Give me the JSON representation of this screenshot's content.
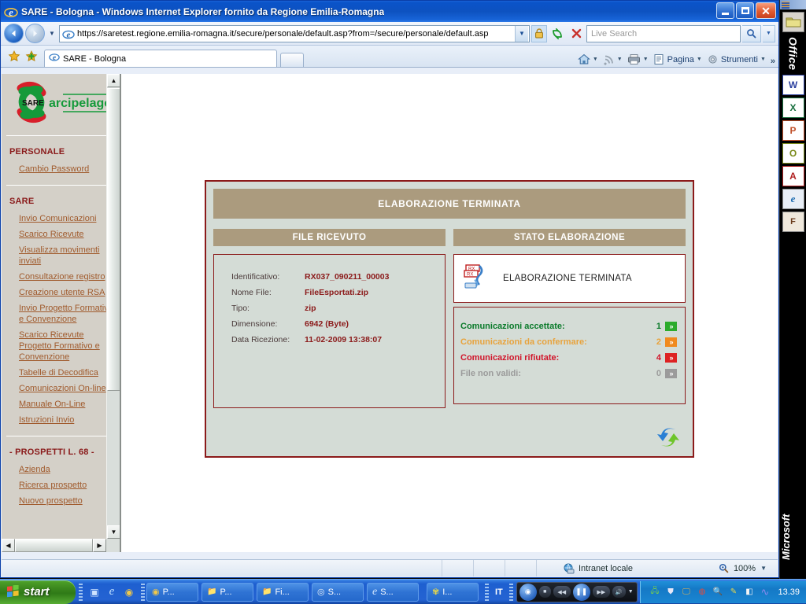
{
  "window": {
    "title": "SARE - Bologna - Windows Internet Explorer fornito da Regione Emilia-Romagna",
    "minimize_label": "",
    "maximize_label": "",
    "close_label": "✕"
  },
  "navbar": {
    "back_label": "◀",
    "forward_label": "▶",
    "history_caret": "▼",
    "url": "https://saretest.regione.emilia-romagna.it/secure/personale/default.asp?from=/secure/personale/default.asp",
    "url_dropdown_caret": "▼",
    "refresh_label": "↻",
    "stop_label": "✕",
    "search_placeholder": "Live Search",
    "search_go_label": "🔍",
    "search_caret": "▼"
  },
  "tabs": {
    "favorites_add_label": "★",
    "favorites_star_label": "✚",
    "items": [
      {
        "label": "SARE - Bologna"
      }
    ],
    "new_tab_label": ""
  },
  "command_bar": {
    "home_label": "",
    "feeds_label": "",
    "print_label": "",
    "page_label": "Pagina",
    "tools_label": "Strumenti",
    "overflow_label": "»",
    "caret": "▼"
  },
  "sidebar": {
    "logo_text": "SARE",
    "logo_word": "arcipelago",
    "sections": [
      {
        "heading": "PERSONALE",
        "links": [
          "Cambio Password"
        ]
      },
      {
        "heading": "SARE",
        "links": [
          "Invio Comunicazioni",
          "Scarico Ricevute",
          "Visualizza movimenti inviati",
          "Consultazione registro",
          "Creazione utente RSA",
          "Invio Progetto Formativo e Convenzione",
          "Scarico Ricevute Progetto Formativo e Convenzione",
          "Tabelle di Decodifica",
          "Comunicazioni On-line",
          "Manuale On-Line",
          "Istruzioni Invio"
        ]
      },
      {
        "heading": "- PROSPETTI L. 68 -",
        "links": [
          "Azienda",
          "Ricerca prospetto",
          "Nuovo prospetto"
        ]
      }
    ],
    "scroll_up_label": "▲",
    "scroll_down_label": "▼",
    "scroll_left_label": "◀",
    "scroll_right_label": "▶"
  },
  "panel": {
    "banner": "ELABORAZIONE TERMINATA",
    "left_column_header": "FILE RICEVUTO",
    "right_column_header": "STATO ELABORAZIONE",
    "file_details": [
      {
        "key": "Identificativo:",
        "value": "RX037_090211_00003"
      },
      {
        "key": "Nome File:",
        "value": "FileEsportati.zip"
      },
      {
        "key": "Tipo:",
        "value": "zip"
      },
      {
        "key": "Dimensione:",
        "value": "6942 (Byte)"
      },
      {
        "key": "Data Ricezione:",
        "value": "11-02-2009 13:38:07"
      }
    ],
    "status_title": "ELABORAZIONE TERMINATA",
    "stats": [
      {
        "label": "Comunicazioni accettate:",
        "count": "1",
        "color": "#0a7a2a",
        "badge": "#2cab2c",
        "arrows": "»"
      },
      {
        "label": "Comunicazioni da confermare:",
        "count": "2",
        "color": "#e8a33d",
        "badge": "#f08a1e",
        "arrows": "»"
      },
      {
        "label": "Comunicazioni rifiutate:",
        "count": "4",
        "color": "#d1152a",
        "badge": "#dd2222",
        "arrows": "»"
      },
      {
        "label": "File non validi:",
        "count": "0",
        "color": "#9b9b9b",
        "badge": "#9b9b9b",
        "arrows": "»"
      }
    ],
    "refresh_button_label": ""
  },
  "statusbar": {
    "zone": "Intranet locale",
    "zoom": "100%",
    "zoom_caret": "▼"
  },
  "office_bar": {
    "top_label": "Office",
    "bottom_label": "Microsoft",
    "buttons": [
      {
        "name": "folder",
        "glyph": "📁",
        "color": "#b8a24a"
      },
      {
        "name": "word",
        "glyph": "W",
        "color": "#2a3f9e"
      },
      {
        "name": "excel",
        "glyph": "X",
        "color": "#1a7040"
      },
      {
        "name": "powerpoint",
        "glyph": "P",
        "color": "#c0502a"
      },
      {
        "name": "outlook",
        "glyph": "O",
        "color": "#7a8a1a"
      },
      {
        "name": "access",
        "glyph": "A",
        "color": "#b02020"
      },
      {
        "name": "explorer",
        "glyph": "e",
        "color": "#1a6ab0"
      },
      {
        "name": "frontpage",
        "glyph": "F",
        "color": "#6a3a1a"
      }
    ]
  },
  "taskbar": {
    "start_label": "start",
    "quick_launch": [
      {
        "name": "show-desktop-icon",
        "glyph": "▣"
      },
      {
        "name": "internet-explorer-icon",
        "glyph": "e"
      },
      {
        "name": "media-player-icon",
        "glyph": "◉"
      }
    ],
    "items": [
      {
        "icon": "◉",
        "label": "P..."
      },
      {
        "icon": "📁",
        "label": "P..."
      },
      {
        "icon": "📁",
        "label": "Fi..."
      },
      {
        "icon": "◎",
        "label": "S..."
      },
      {
        "icon": "e",
        "label": "S..."
      },
      {
        "icon": "✾",
        "label": "I..."
      }
    ],
    "language": "IT",
    "media": {
      "logo": "◉",
      "stop": "■",
      "prev": "◀◀",
      "pause": "❚❚",
      "next": "▶▶",
      "volume": "🔊",
      "volume_caret": "▼"
    },
    "tray_icons": [
      {
        "name": "network-icon",
        "glyph": "🖧",
        "color": "#7ad04a"
      },
      {
        "name": "security-icon",
        "glyph": "⛊",
        "color": "#d8d8e8"
      },
      {
        "name": "display-icon",
        "glyph": "🖵",
        "color": "#e8a33d"
      },
      {
        "name": "opera-icon",
        "glyph": "◍",
        "color": "#d82a2a"
      },
      {
        "name": "search-icon",
        "glyph": "🔍",
        "color": "#5ad0f0"
      },
      {
        "name": "pen-icon",
        "glyph": "✎",
        "color": "#d8c84a"
      },
      {
        "name": "eraser-icon",
        "glyph": "◧",
        "color": "#f0f0f0"
      },
      {
        "name": "wave-icon",
        "glyph": "∿",
        "color": "#7a7ae8"
      }
    ],
    "clock": "13.39"
  }
}
